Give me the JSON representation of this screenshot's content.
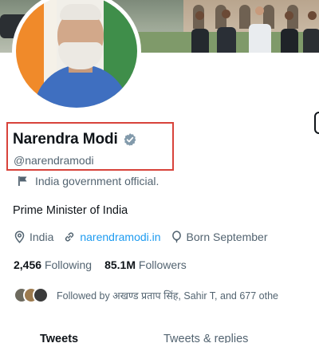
{
  "profile": {
    "name": "Narendra Modi",
    "handle": "@narendramodi",
    "label": "India government official.",
    "bio": "Prime Minister of India",
    "location": "India",
    "website": "narendramodi.in",
    "born": "Born September",
    "following_count": "2,456",
    "following_label": "Following",
    "followers_count": "85.1M",
    "followers_label": "Followers",
    "followed_by": "Followed by अखण्ड प्रताप सिंह, Sahir T, and 677 othe"
  },
  "tabs": [
    {
      "label": "Tweets"
    },
    {
      "label": "Tweets & replies"
    }
  ],
  "colors": {
    "accent": "#1d9bf0",
    "verified": "#829aab",
    "highlight_box": "#d8433b"
  },
  "icons": {
    "verified": "verified-badge-icon",
    "label": "flag-icon",
    "location": "location-pin-icon",
    "website": "link-icon",
    "born": "balloon-icon"
  }
}
